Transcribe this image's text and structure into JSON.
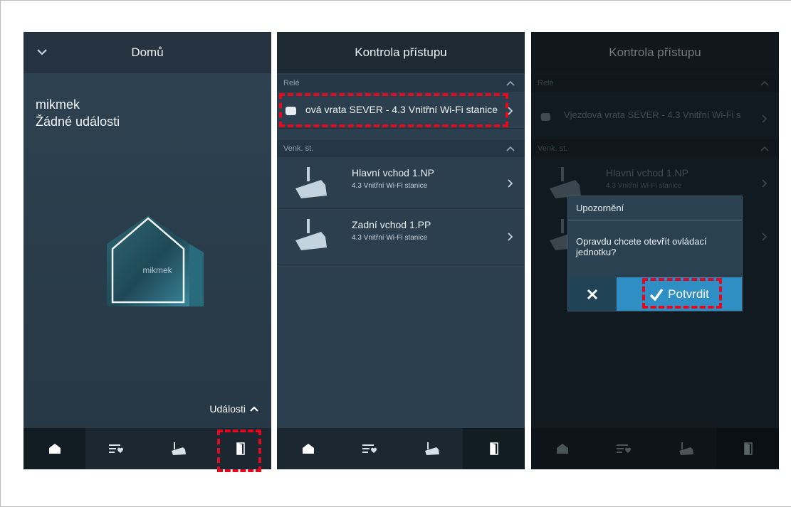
{
  "panel1": {
    "header_title": "Domů",
    "home_name": "mikmek",
    "no_events": "Žádné události",
    "house_label": "mikmek",
    "events_link": "Události"
  },
  "panel2": {
    "header_title": "Kontrola přístupu",
    "relay_section": "Relé",
    "relay_item": "ová vrata SEVER - 4.3 Vnitřní Wi-Fi stanice",
    "outdoor_section": "Venk. st.",
    "stations": [
      {
        "title": "Hlavní vchod 1.NP",
        "subtitle": "4.3 Vnitřní Wi-Fi stanice"
      },
      {
        "title": "Zadní vchod 1.PP",
        "subtitle": "4.3 Vnitřní Wi-Fi stanice"
      }
    ]
  },
  "panel3": {
    "header_title": "Kontrola přístupu",
    "relay_section": "Relé",
    "relay_item": "Vjezdová vrata SEVER - 4.3 Vnitřní Wi-Fi s",
    "outdoor_section": "Venk. st.",
    "stations": [
      {
        "title": "Hlavní vchod 1.NP",
        "subtitle": "4.3 Vnitřní Wi-Fi stanice"
      }
    ],
    "dialog": {
      "title": "Upozornění",
      "message": "Opravdu chcete otevřít ovládací jednotku?",
      "confirm_label": "Potvrdit"
    }
  },
  "icons": {
    "header_expand": "chevron-down-icon",
    "nav": [
      "home-icon",
      "events-list-icon",
      "camera-icon",
      "door-icon"
    ],
    "relay": "relay-hand-icon",
    "station": "camera-icon",
    "row_arrow": "chevron-right-icon",
    "cancel": "close-icon",
    "confirm": "checkmark-icon"
  },
  "colors": {
    "highlight": "#e3091f",
    "confirm_button": "#2f8fc5",
    "panel_bg": "#2b3f4e"
  }
}
